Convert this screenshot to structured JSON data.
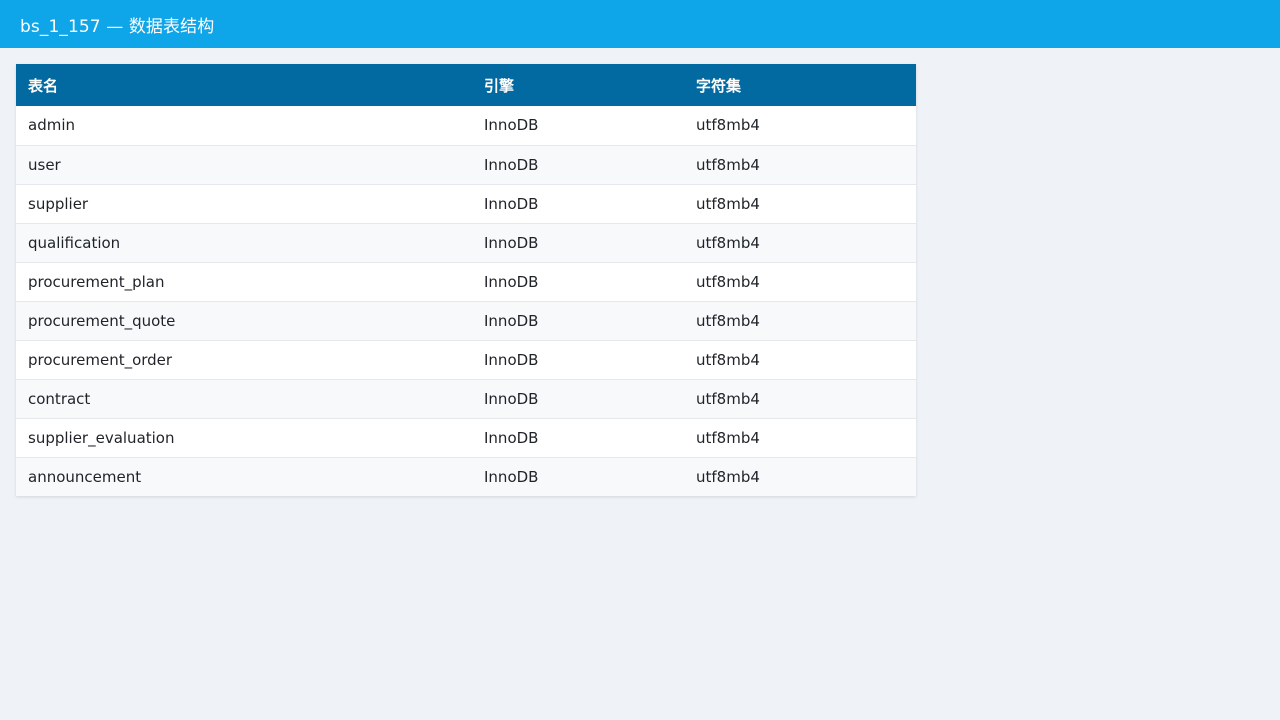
{
  "header": {
    "title": "bs_1_157 — 数据表结构"
  },
  "table": {
    "columns": [
      "表名",
      "引擎",
      "字符集"
    ],
    "rows": [
      [
        "admin",
        "InnoDB",
        "utf8mb4"
      ],
      [
        "user",
        "InnoDB",
        "utf8mb4"
      ],
      [
        "supplier",
        "InnoDB",
        "utf8mb4"
      ],
      [
        "qualification",
        "InnoDB",
        "utf8mb4"
      ],
      [
        "procurement_plan",
        "InnoDB",
        "utf8mb4"
      ],
      [
        "procurement_quote",
        "InnoDB",
        "utf8mb4"
      ],
      [
        "procurement_order",
        "InnoDB",
        "utf8mb4"
      ],
      [
        "contract",
        "InnoDB",
        "utf8mb4"
      ],
      [
        "supplier_evaluation",
        "InnoDB",
        "utf8mb4"
      ],
      [
        "announcement",
        "InnoDB",
        "utf8mb4"
      ]
    ]
  },
  "colors": {
    "topbar": "#0ea5e9",
    "table_header": "#0369a1",
    "page_background": "#eff3f8"
  }
}
